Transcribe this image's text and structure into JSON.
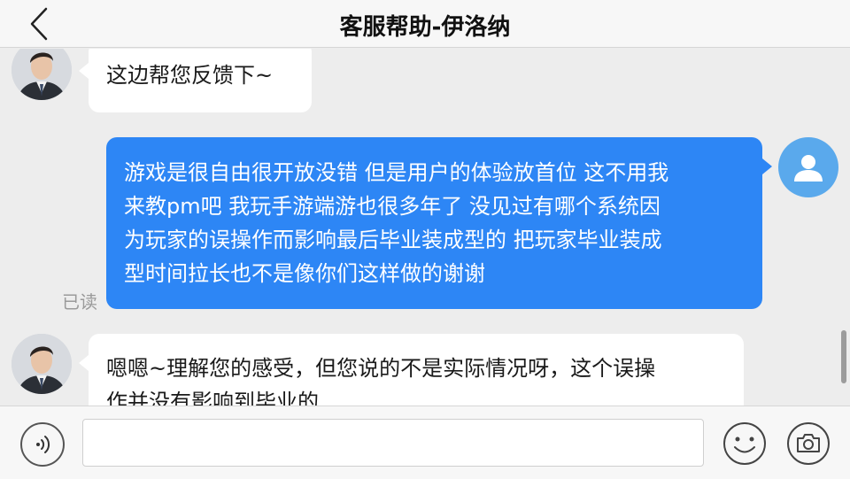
{
  "header": {
    "title": "客服帮助-伊洛纳",
    "back_icon": "chevron-left-icon"
  },
  "messages": [
    {
      "side": "in",
      "sender": "agent",
      "text": "这边帮您反馈下~"
    },
    {
      "side": "out",
      "sender": "user",
      "lines": [
        "游戏是很自由很开放没错 但是用户的体验放首位 这不用我",
        "来教pm吧 我玩手游端游也很多年了 没见过有哪个系统因",
        "为玩家的误操作而影响最后毕业装成型的 把玩家毕业装成",
        "型时间拉长也不是像你们这样做的谢谢"
      ],
      "status": "已读"
    },
    {
      "side": "in",
      "sender": "agent",
      "lines": [
        "嗯嗯~理解您的感受，但您说的不是实际情况呀，这个误操",
        "作并没有影响到毕业的"
      ]
    }
  ],
  "footer": {
    "input_value": "",
    "input_placeholder": "",
    "voice_icon": "voice-icon",
    "emoji_icon": "emoji-icon",
    "camera_icon": "camera-icon"
  },
  "colors": {
    "outgoing_bubble": "#2d86f5",
    "incoming_bubble": "#ffffff",
    "background": "#ededed",
    "user_avatar": "#5aa9ec"
  }
}
